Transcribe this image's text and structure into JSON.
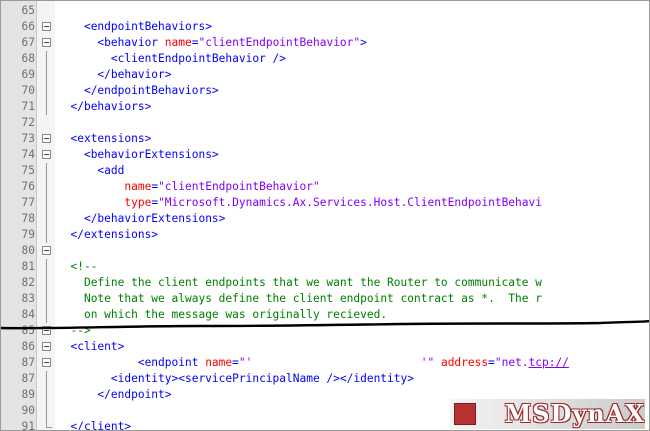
{
  "lines": [
    {
      "n": "65",
      "text": ""
    },
    {
      "n": "66",
      "pre": "    ",
      "open": "<endpointBehaviors>"
    },
    {
      "n": "67",
      "pre": "      ",
      "open": "<behavior ",
      "attr": "name",
      "eq": "=",
      "val": "\"clientEndpointBehavior\"",
      "close": ">"
    },
    {
      "n": "68",
      "pre": "        ",
      "open": "<clientEndpointBehavior />"
    },
    {
      "n": "69",
      "pre": "      ",
      "open": "</behavior>"
    },
    {
      "n": "70",
      "pre": "    ",
      "open": "</endpointBehaviors>"
    },
    {
      "n": "71",
      "pre": "  ",
      "open": "</behaviors>"
    },
    {
      "n": "72",
      "text": ""
    },
    {
      "n": "73",
      "pre": "  ",
      "open": "<extensions>"
    },
    {
      "n": "74",
      "pre": "    ",
      "open": "<behaviorExtensions>"
    },
    {
      "n": "75",
      "pre": "      ",
      "open": "<add"
    },
    {
      "n": "76",
      "pre": "          ",
      "attr": "name",
      "eq": "=",
      "val": "\"clientEndpointBehavior\""
    },
    {
      "n": "77",
      "pre": "          ",
      "attr": "type",
      "eq": "=",
      "val": "\"Microsoft.Dynamics.Ax.Services.Host.ClientEndpointBehavi"
    },
    {
      "n": "78",
      "pre": "    ",
      "open": "</behaviorExtensions>"
    },
    {
      "n": "79",
      "pre": "  ",
      "open": "</extensions>"
    },
    {
      "n": "80",
      "text": ""
    },
    {
      "n": "81",
      "pre": "  ",
      "comment": "<!--"
    },
    {
      "n": "82",
      "pre": "    ",
      "comment": "Define the client endpoints that we want the Router to communicate w"
    },
    {
      "n": "83",
      "pre": "    ",
      "comment": "Note that we always define the client endpoint contract as *.  The r"
    },
    {
      "n": "84",
      "pre": "    ",
      "comment": "on which the message was originally recieved."
    },
    {
      "n": "85",
      "pre": "  ",
      "comment": "-->"
    },
    {
      "n": "86",
      "pre": "  ",
      "open": "<client>"
    },
    {
      "n": "87",
      "pre": "            ",
      "open": "<endpoint ",
      "attr": "name",
      "eq": "=",
      "val": "\"'                         '\"",
      "tail_attr": " address",
      "tail_eq": "=",
      "tail_val": "\"net.",
      "tail_link": "tcp://"
    },
    {
      "n": "87",
      "pre": "        ",
      "open": "<identity><servicePrincipalName /></identity>"
    },
    {
      "n": "89",
      "pre": "      ",
      "open": "</endpoint>"
    },
    {
      "n": "90",
      "text": ""
    },
    {
      "n": "91",
      "pre": "  ",
      "open": "</client>"
    }
  ],
  "watermark": "MSDynAX"
}
